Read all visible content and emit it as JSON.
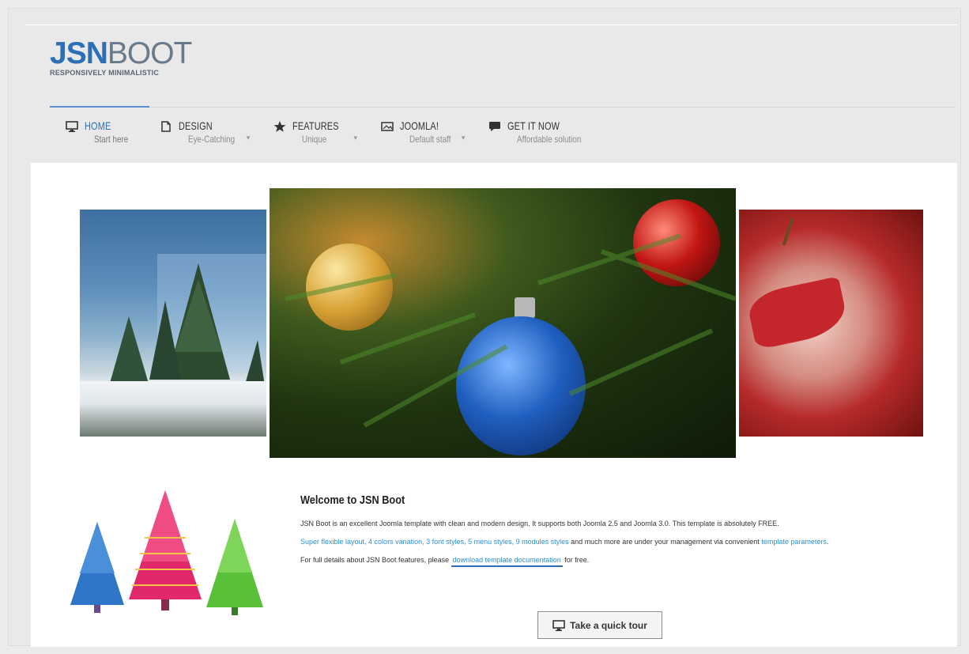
{
  "logo": {
    "bold": "JSN",
    "light": "BOOT",
    "tagline": "RESPONSIVELY MINIMALISTIC"
  },
  "nav": [
    {
      "icon": "monitor-icon",
      "label": "HOME",
      "sub": "Start here",
      "active": true
    },
    {
      "icon": "document-icon",
      "label": "DESIGN",
      "sub": "Eye-Catching",
      "dropdown": true
    },
    {
      "icon": "star-icon",
      "label": "FEATURES",
      "sub": "Unique",
      "dropdown": true
    },
    {
      "icon": "image-icon",
      "label": "JOOMLA!",
      "sub": "Default staff",
      "dropdown": true
    },
    {
      "icon": "chat-icon",
      "label": "GET IT NOW",
      "sub": "Affordable solution"
    }
  ],
  "main": {
    "title": "Welcome to JSN Boot",
    "intro": "JSN Boot is an excellent Joomla template with clean and modern design. It supports both Joomla 2.5 and Joomla 3.0. This template is absolutely FREE.",
    "features_links": "Super flexible layout, 4 colors variation, 3 font styles, 5 menu styles, 9 modules styles",
    "features_text": " and much more are under your management via convenient ",
    "features_link2": "template parameters",
    "features_end": ".",
    "details_prefix": "For full details about JSN Boot features, please ",
    "details_link": "download template documentation",
    "details_suffix": " for free.",
    "tour_button": "Take a quick tour"
  },
  "colors": {
    "accent": "#2b6fb6",
    "link": "#2b8fd6"
  }
}
